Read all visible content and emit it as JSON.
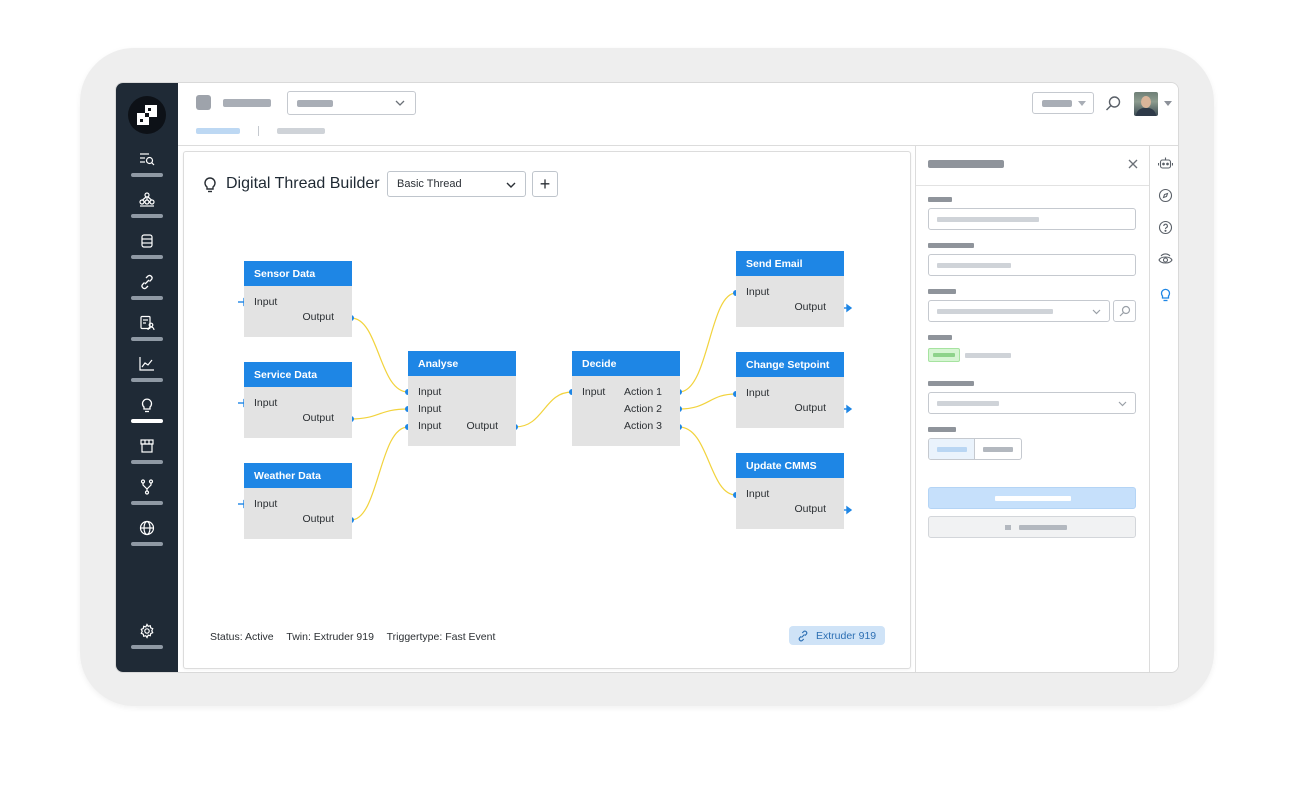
{
  "app": {
    "canvas_title": "Digital Thread Builder",
    "thread_select_value": "Basic Thread",
    "add_button_label": "+"
  },
  "nodes": {
    "sensor": {
      "title": "Sensor Data",
      "inputs": [
        "Input"
      ],
      "outputs": [
        "Output"
      ]
    },
    "service": {
      "title": "Service Data",
      "inputs": [
        "Input"
      ],
      "outputs": [
        "Output"
      ]
    },
    "weather": {
      "title": "Weather Data",
      "inputs": [
        "Input"
      ],
      "outputs": [
        "Output"
      ]
    },
    "analyse": {
      "title": "Analyse",
      "inputs": [
        "Input",
        "Input",
        "Input"
      ],
      "outputs": [
        "Output"
      ]
    },
    "decide": {
      "title": "Decide",
      "inputs": [
        "Input"
      ],
      "outputs": [
        "Action 1",
        "Action 2",
        "Action 3"
      ]
    },
    "email": {
      "title": "Send Email",
      "inputs": [
        "Input"
      ],
      "outputs": [
        "Output"
      ]
    },
    "setpoint": {
      "title": "Change Setpoint",
      "inputs": [
        "Input"
      ],
      "outputs": [
        "Output"
      ]
    },
    "cmms": {
      "title": "Update CMMS",
      "inputs": [
        "Input"
      ],
      "outputs": [
        "Output"
      ]
    }
  },
  "status": {
    "status_text": "Status: Active",
    "twin_text": "Twin: Extruder 919",
    "trigger_text": "Triggertype: Fast Event",
    "twin_chip_label": "Extruder 919"
  },
  "colors": {
    "sidebar_bg": "#1f2a36",
    "node_header": "#1e86e5",
    "node_body": "#e3e3e3",
    "connector": "#f2d33d",
    "port_dot": "#1e86e5",
    "chip_bg": "#cfe3f7"
  },
  "icons": {
    "sidebar": [
      "list-search-icon",
      "hierarchy-icon",
      "database-icon",
      "link-icon",
      "document-user-icon",
      "chart-line-icon",
      "lightbulb-icon",
      "store-icon",
      "branch-icon",
      "globe-icon",
      "settings-icon"
    ],
    "rail": [
      "robot-icon",
      "compass-icon",
      "help-icon",
      "eye-icon",
      "lightbulb-icon"
    ]
  }
}
